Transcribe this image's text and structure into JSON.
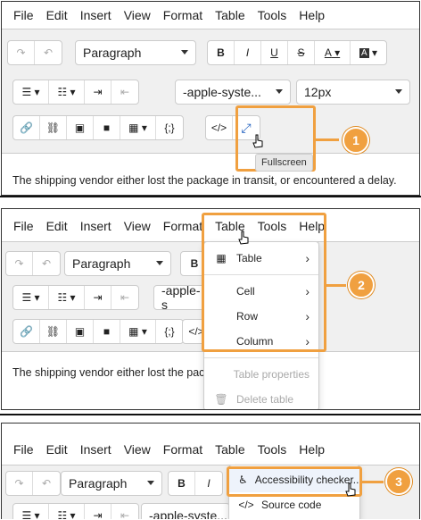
{
  "menubar": [
    "File",
    "Edit",
    "Insert",
    "View",
    "Format",
    "Table",
    "Tools",
    "Help"
  ],
  "toolbar": {
    "block_format": "Paragraph",
    "font_family": "-apple-syste...",
    "font_family_short": "-apple-s",
    "font_size": "12px",
    "bold": "B",
    "italic": "I",
    "underline": "U",
    "strike": "S",
    "font_color": "A",
    "code_sample": "{;}",
    "source": "</>",
    "highlight_box": "A"
  },
  "content_text": "The shipping vendor either lost the package in transit, or encountered a delay.",
  "content_text_short": "The shipping vendor either lost the packag",
  "tooltip": "Fullscreen",
  "table_menu": {
    "items": [
      {
        "label": "Table",
        "icon": "table-grid-icon",
        "submenu": true
      },
      {
        "label": "Cell",
        "submenu": true
      },
      {
        "label": "Row",
        "submenu": true
      },
      {
        "label": "Column",
        "submenu": true
      },
      {
        "label": "Table properties",
        "disabled": true
      },
      {
        "label": "Delete table",
        "icon": "trash-icon",
        "disabled": true
      }
    ]
  },
  "tools_menu": {
    "items": [
      {
        "label": "Accessibility checker...",
        "icon": "accessibility-icon"
      },
      {
        "label": "Source code",
        "icon": "code-icon"
      }
    ]
  },
  "callouts": [
    "1",
    "2",
    "3"
  ],
  "colors": {
    "accent": "#f0a040",
    "toolbar_bg": "#f0f0f0",
    "fullscreen_icon": "#1f5fbf"
  }
}
